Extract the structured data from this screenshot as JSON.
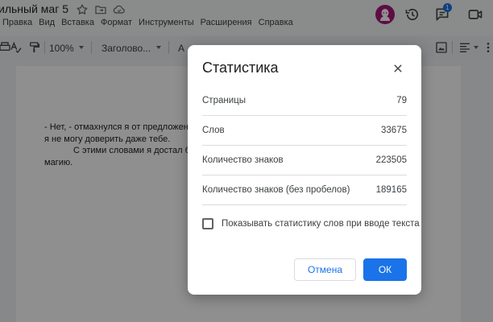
{
  "header": {
    "doc_title": "ильный маг 5",
    "menu": [
      "Правка",
      "Вид",
      "Вставка",
      "Формат",
      "Инструменты",
      "Расширения",
      "Справка"
    ],
    "notification_count": "1"
  },
  "toolbar": {
    "zoom": "100%",
    "style": "Заголово...",
    "font_fragment": "A"
  },
  "document": {
    "lines": [
      "- Нет, - отмахнулся я от предложен",
      "я не могу доверить даже тебе.",
      "С этими словами я достал б",
      "магию."
    ]
  },
  "dialog": {
    "title": "Статистика",
    "stats": [
      {
        "label": "Страницы",
        "value": "79"
      },
      {
        "label": "Слов",
        "value": "33675"
      },
      {
        "label": "Количество знаков",
        "value": "223505"
      },
      {
        "label": "Количество знаков (без пробелов)",
        "value": "189165"
      }
    ],
    "checkbox_label": "Показывать статистику слов при вводе текста",
    "checkbox_checked": false,
    "cancel_label": "Отмена",
    "ok_label": "ОК"
  },
  "colors": {
    "accent": "#1a73e8",
    "avatar": "#a8177a"
  }
}
